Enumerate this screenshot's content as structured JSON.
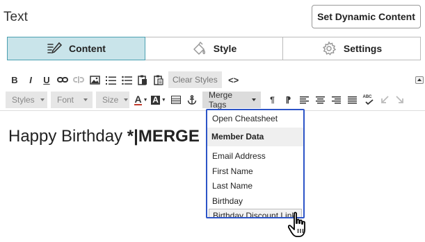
{
  "panel": {
    "title": "Text"
  },
  "header": {
    "dynamic_button": "Set Dynamic Content"
  },
  "tabs": [
    {
      "label": "Content",
      "icon": "pencil-lines-icon",
      "active": true
    },
    {
      "label": "Style",
      "icon": "paint-bucket-icon",
      "active": false
    },
    {
      "label": "Settings",
      "icon": "gear-icon",
      "active": false
    }
  ],
  "toolbar": {
    "bold": "B",
    "italic": "I",
    "underline": "U",
    "clear_styles": "Clear Styles",
    "source": "<>",
    "styles_label": "Styles",
    "font_label": "Font",
    "size_label": "Size",
    "text_color_glyph": "A",
    "bg_color_glyph": "A",
    "merge_tags_label": "Merge Tags",
    "pilcrow": "¶",
    "rtl_pilcrow": "⁋",
    "spellcheck": "ABC"
  },
  "editor": {
    "text_plain": "Happy Birthday ",
    "text_bold": "*|MERGE"
  },
  "merge_menu": {
    "open_cheatsheet": "Open Cheatsheet",
    "section_header": "Member Data",
    "items": [
      "Email Address",
      "First Name",
      "Last Name",
      "Birthday",
      "Birthday Discount Link"
    ],
    "hovered_item": "Birthday Discount Link"
  },
  "colors": {
    "accent": "#2c54c7",
    "tab_active_bg": "#c9e4ea",
    "tab_active_border": "#4a9fb0"
  }
}
